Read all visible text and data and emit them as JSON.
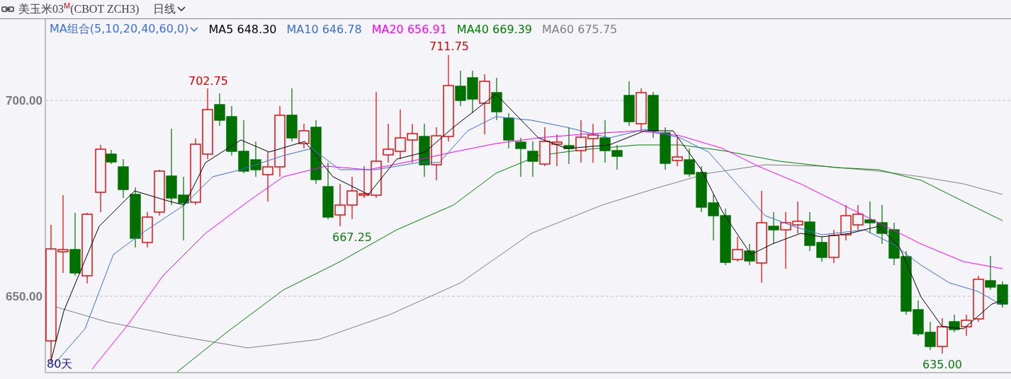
{
  "header": {
    "instrument": "美玉米03",
    "mark": "M",
    "code": "(CBOT ZCH3)",
    "period": "日线"
  },
  "legend": {
    "indicator": "MA组合(5,10,20,40,60,0)",
    "items": [
      {
        "label": "MA5",
        "value": "648.30",
        "color": "#000000"
      },
      {
        "label": "MA10",
        "value": "646.78",
        "color": "#3a6fd8"
      },
      {
        "label": "MA20",
        "value": "656.91",
        "color": "#ff00ff"
      },
      {
        "label": "MA40",
        "value": "669.39",
        "color": "#008000"
      },
      {
        "label": "MA60",
        "value": "675.75",
        "color": "#808080"
      }
    ]
  },
  "chart": {
    "y_labels": [
      "700.00",
      "650.00"
    ],
    "peak_labels": [
      {
        "text": "702.75",
        "kind": "high"
      },
      {
        "text": "711.75",
        "kind": "high"
      },
      {
        "text": "667.25",
        "kind": "low"
      },
      {
        "text": "635.00",
        "kind": "low"
      }
    ],
    "range_label": "80天"
  }
}
